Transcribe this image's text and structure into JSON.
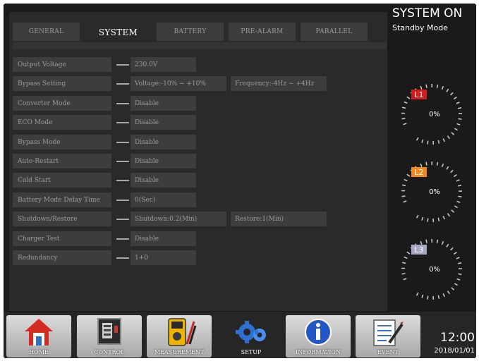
{
  "tabs": [
    {
      "label": "GENERAL",
      "active": false
    },
    {
      "label": "SYSTEM",
      "active": true
    },
    {
      "label": "BATTERY",
      "active": false
    },
    {
      "label": "PRE-ALARM",
      "active": false
    },
    {
      "label": "PARALLEL",
      "active": false
    }
  ],
  "settings": [
    {
      "label": "Output Voltage",
      "values": [
        "230.0V"
      ]
    },
    {
      "label": "Bypass Setting",
      "values": [
        "Voltage:-10% ~ +10%",
        "Frequency:-4Hz ~ +4Hz"
      ]
    },
    {
      "label": "Converter Mode",
      "values": [
        "Disable"
      ]
    },
    {
      "label": "ECO Mode",
      "values": [
        "Disable"
      ]
    },
    {
      "label": "Bypass Mode",
      "values": [
        "Disable"
      ]
    },
    {
      "label": "Auto-Restart",
      "values": [
        "Disable"
      ]
    },
    {
      "label": "Cold Start",
      "values": [
        "Disable"
      ]
    },
    {
      "label": "Battery Mode Delay Time",
      "values": [
        "0(Sec)"
      ]
    },
    {
      "label": "Shutdown/Restore",
      "values": [
        "Shutdown:0.2(Min)",
        "Restore:1(Min)"
      ]
    },
    {
      "label": "Charger Test",
      "values": [
        "Disable"
      ]
    },
    {
      "label": "Redundancy",
      "values": [
        "1+0"
      ]
    }
  ],
  "status": {
    "title": "SYSTEM ON",
    "mode": "Standby Mode"
  },
  "gauges": [
    {
      "label": "L1",
      "value": "0%",
      "color": "#d21b1b"
    },
    {
      "label": "L2",
      "value": "0%",
      "color": "#f08a1c"
    },
    {
      "label": "L3",
      "value": "0%",
      "color": "#a7a7c4"
    }
  ],
  "nav": [
    {
      "label": "HOME",
      "icon": "home-icon"
    },
    {
      "label": "CONTROL",
      "icon": "control-panel-icon"
    },
    {
      "label": "MEASUREMENT",
      "icon": "multimeter-icon"
    },
    {
      "label": "SETUP",
      "icon": "gears-icon"
    },
    {
      "label": "INFORMATION",
      "icon": "info-icon"
    },
    {
      "label": "EVENT",
      "icon": "event-log-icon"
    }
  ],
  "clock": {
    "time": "12:00",
    "date": "2018/01/01"
  }
}
